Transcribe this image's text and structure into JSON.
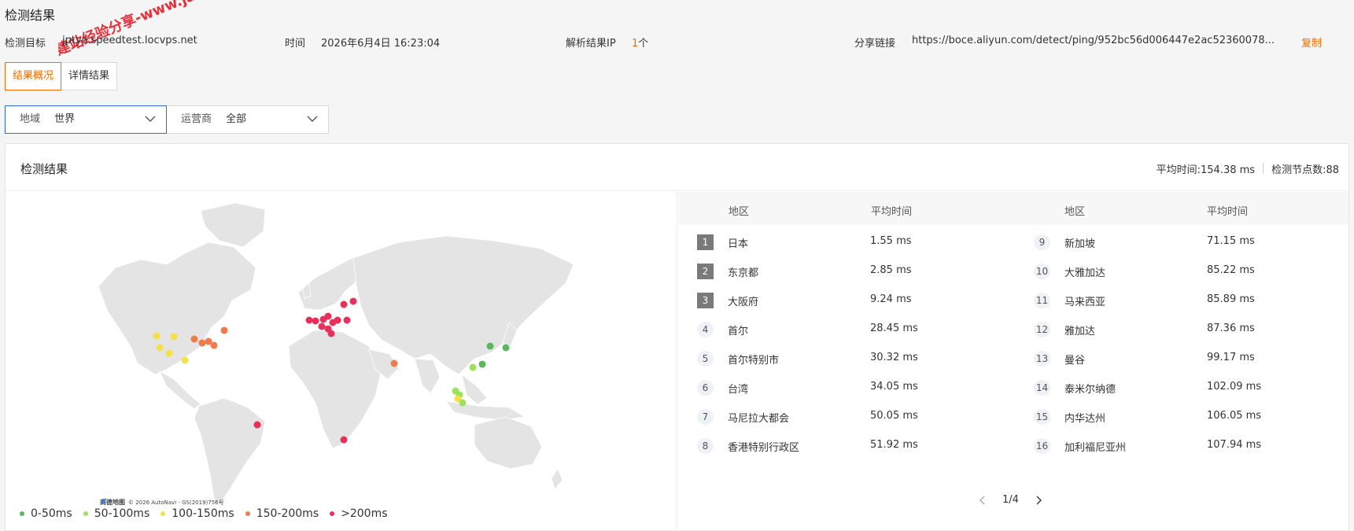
{
  "page_title": "检测结果",
  "watermark_text": "建站经验分享-www.ja",
  "info": {
    "target_label": "检测目标",
    "target_value": "jptyo.speedtest.locvps.net",
    "time_label": "时间",
    "time_value": "2026年6月4日 16:23:04",
    "ip_label": "解析结果IP",
    "ip_count": "1",
    "ip_unit": "个",
    "share_label": "分享链接",
    "share_url": "https://boce.aliyun.com/detect/ping/952bc56d006447e2ac52360078...",
    "copy_label": "复制"
  },
  "tabs": [
    {
      "label": "结果概况",
      "active": true
    },
    {
      "label": "详情结果",
      "active": false
    }
  ],
  "filters": {
    "region_label": "地域",
    "region_value": "世界",
    "isp_label": "运营商",
    "isp_value": "全部"
  },
  "panel": {
    "title": "检测结果",
    "avg_time": "平均时间:154.38 ms",
    "node_count": "检测节点数:88"
  },
  "map": {
    "attribution_brand": "高德地图",
    "attribution_text": "© 2026 AutoNavi - GS(2019)756号"
  },
  "legend": [
    {
      "label": "0-50ms",
      "color": "#5cb85c"
    },
    {
      "label": "50-100ms",
      "color": "#9be35a"
    },
    {
      "label": "100-150ms",
      "color": "#f5e04a"
    },
    {
      "label": "150-200ms",
      "color": "#f07a4a"
    },
    {
      "label": ">200ms",
      "color": "#e8305a"
    }
  ],
  "table": {
    "headers": {
      "area": "地区",
      "time": "平均时间"
    },
    "rows": [
      {
        "rank": "1",
        "area": "日本",
        "time": "1.55 ms"
      },
      {
        "rank": "2",
        "area": "东京都",
        "time": "2.85 ms"
      },
      {
        "rank": "3",
        "area": "大阪府",
        "time": "9.24 ms"
      },
      {
        "rank": "4",
        "area": "首尔",
        "time": "28.45 ms"
      },
      {
        "rank": "5",
        "area": "首尔特别市",
        "time": "30.32 ms"
      },
      {
        "rank": "6",
        "area": "台湾",
        "time": "34.05 ms"
      },
      {
        "rank": "7",
        "area": "马尼拉大都会",
        "time": "50.05 ms"
      },
      {
        "rank": "8",
        "area": "香港特别行政区",
        "time": "51.92 ms"
      },
      {
        "rank": "9",
        "area": "新加坡",
        "time": "71.15 ms"
      },
      {
        "rank": "10",
        "area": "大雅加达",
        "time": "85.22 ms"
      },
      {
        "rank": "11",
        "area": "马来西亚",
        "time": "85.89 ms"
      },
      {
        "rank": "12",
        "area": "雅加达",
        "time": "87.36 ms"
      },
      {
        "rank": "13",
        "area": "曼谷",
        "time": "99.17 ms"
      },
      {
        "rank": "14",
        "area": "泰米尔纳德",
        "time": "102.09 ms"
      },
      {
        "rank": "15",
        "area": "内华达州",
        "time": "106.05 ms"
      },
      {
        "rank": "16",
        "area": "加利福尼亚州",
        "time": "107.94 ms"
      }
    ],
    "pager": "1/4"
  }
}
